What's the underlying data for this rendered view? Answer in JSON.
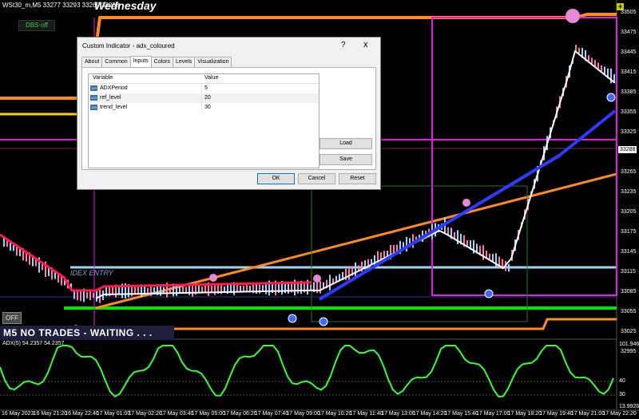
{
  "chart": {
    "symbol_title": "WSt30_m,M5  33277 33293 33269 33288",
    "day_label": "Wednesday",
    "dbs_button": "DBS-off",
    "plus_button": "+",
    "off_button": "OFF",
    "status_banner": "M5  NO TRADES - WAITING . . .",
    "zone_label": "IDEX ENTRY",
    "current_price": "33288",
    "price_ticks": [
      "33505",
      "33475",
      "33445",
      "33415",
      "33385",
      "33355",
      "33325",
      "33295",
      "33265",
      "33235",
      "33205",
      "33175",
      "33145",
      "33115",
      "33085",
      "33055",
      "33025",
      "32995"
    ],
    "time_ticks": [
      "16 May 2023",
      "16 May 21:20",
      "16 May 22:40",
      "17 May 01:00",
      "17 May 02:20",
      "17 May 03:40",
      "17 May 05:00",
      "17 May 06:20",
      "17 May 07:40",
      "17 May 09:00",
      "17 May 10:20",
      "17 May 11:40",
      "17 May 13:00",
      "17 May 14:20",
      "17 May 15:40",
      "17 May 17:00",
      "17 May 18:20",
      "17 May 19:40",
      "17 May 21:00",
      "17 May 22:20"
    ],
    "adx_label": "ADX(5) 54.2357 54.2357",
    "adx_ticks": [
      "101.9462",
      "40",
      "30",
      "13.9926"
    ],
    "colors": {
      "background": "#000000",
      "ma_fast": "#ff1a4b",
      "ma_white": "#ffffff",
      "ma_blue": "#2b3bff",
      "trend_orange": "#ff8c1a",
      "level_green": "#00e600",
      "level_cyan": "#9fd4f0",
      "level_magenta": "#e619e6",
      "adx_line": "#33ff33"
    }
  },
  "dialog": {
    "title": "Custom Indicator - adx_coloured",
    "help_icon": "?",
    "close_icon": "x",
    "tabs": [
      "About",
      "Common",
      "Inputs",
      "Colors",
      "Levels",
      "Visualization"
    ],
    "active_tab": "Inputs",
    "columns": [
      "Variable",
      "Value"
    ],
    "params": [
      {
        "type": "123",
        "name": "ADXPeriod",
        "value": "5"
      },
      {
        "type": "123",
        "name": "ref_level",
        "value": "20"
      },
      {
        "type": "123",
        "name": "trend_level",
        "value": "30"
      }
    ],
    "buttons": {
      "load": "Load",
      "save": "Save",
      "ok": "OK",
      "cancel": "Cancel",
      "reset": "Reset"
    }
  }
}
